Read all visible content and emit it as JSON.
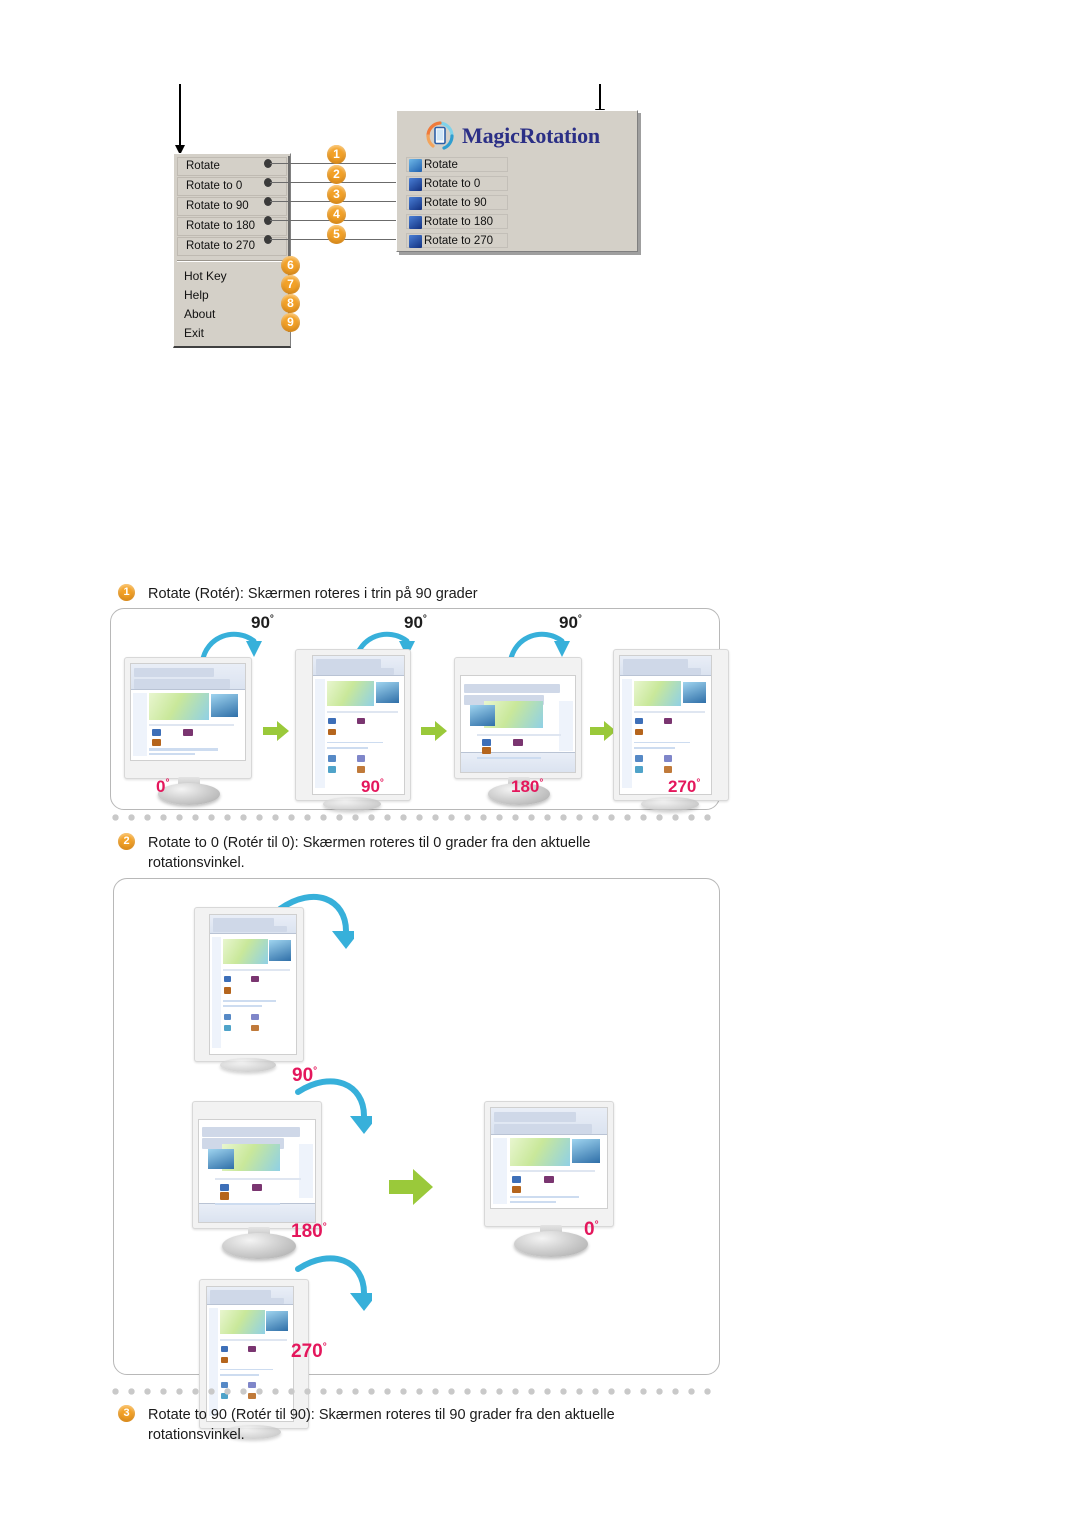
{
  "top_diagram": {
    "context_menu": {
      "name": "MagicRotation tray context menu",
      "items": [
        {
          "label": "Rotate",
          "badge": "1"
        },
        {
          "label": "Rotate to 0",
          "badge": "2"
        },
        {
          "label": "Rotate to 90",
          "badge": "3"
        },
        {
          "label": "Rotate to 180",
          "badge": "4"
        },
        {
          "label": "Rotate to 270",
          "badge": "5"
        }
      ],
      "plain_items": [
        {
          "label": "Hot Key",
          "badge": "6"
        },
        {
          "label": "Help",
          "badge": "7"
        },
        {
          "label": "About",
          "badge": "8"
        },
        {
          "label": "Exit",
          "badge": "9"
        }
      ]
    },
    "panel": {
      "title": "MagicRotation",
      "logo_icon": "magicrotation-logo-icon",
      "items": [
        {
          "label": "Rotate",
          "icon": "rotate-icon",
          "icon_color": "#2e6fc4"
        },
        {
          "label": "Rotate to 0",
          "icon": "rotate-0-icon",
          "icon_color": "#2342a8"
        },
        {
          "label": "Rotate to 90",
          "icon": "rotate-90-icon",
          "icon_color": "#1c3fa6"
        },
        {
          "label": "Rotate to 180",
          "icon": "rotate-180-icon",
          "icon_color": "#21409f"
        },
        {
          "label": "Rotate to 270",
          "icon": "rotate-270-icon",
          "icon_color": "#1b3c9c"
        }
      ]
    }
  },
  "sections": [
    {
      "badge": "1",
      "caption": "Rotate (Rotér): Skærmen roteres i trin på 90 grader"
    },
    {
      "badge": "2",
      "caption": "Rotate to 0 (Rotér til 0): Skærmen roteres til 0 grader fra den aktuelle rotationsvinkel."
    },
    {
      "badge": "3",
      "caption": "Rotate to 90 (Rotér til 90): Skærmen roteres til 90 grader fra den aktuelle rotationsvinkel."
    }
  ],
  "figure1": {
    "name": "rotate-step-sequence",
    "arc_labels": [
      "90",
      "90",
      "90"
    ],
    "angle_labels": [
      "0",
      "90",
      "180",
      "270"
    ],
    "degree_symbol": "°",
    "arrow_count": 3
  },
  "figure2": {
    "name": "rotate-to-0-sequence",
    "arc_labels": [
      "90",
      "180",
      "270"
    ],
    "result_label": "0",
    "degree_symbol": "°"
  },
  "colors": {
    "badge_orange": "#f3a228",
    "angle_pink": "#e4175c",
    "green_arrow": "#9ac93a",
    "arc_blue": "#2fa8d5",
    "logo_blue": "#2b2f86",
    "panel_grey": "#d4d0c8"
  }
}
